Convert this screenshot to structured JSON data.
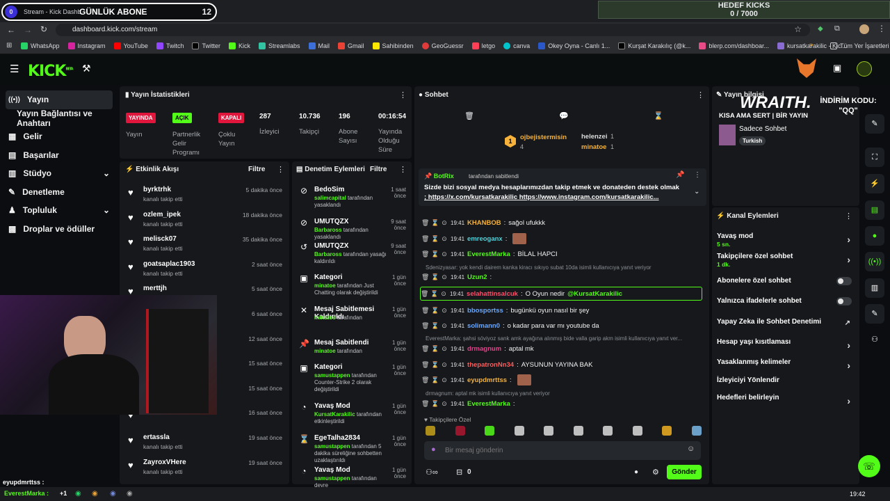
{
  "overlay": {
    "abone_title": "GÜNLÜK ABONE",
    "abone_left": "0",
    "abone_count": "12",
    "hedef_title": "HEDEF KICKS",
    "hedef_value": "0 / 7000"
  },
  "browser": {
    "tab_title": "Stream - Kick Dashb",
    "url": "dashboard.kick.com/stream",
    "all_bookmarks": "Tüm Yer İşaretleri"
  },
  "bookmarks": [
    "WhatsApp",
    "Instagram",
    "YouTube",
    "Twitch",
    "Twitter",
    "Kick",
    "Streamlabs",
    "Mail",
    "Gmail",
    "Sahibinden",
    "GeoGuessr",
    "letgo",
    "canva",
    "Okey Oyna - Canlı 1...",
    "Kurşat Karakılıç (@k...",
    "blerp.com/dashboar...",
    "kursatkarakilic - Kic..."
  ],
  "kick": {
    "logo": "KICK",
    "beta": "BETA"
  },
  "sidebar": {
    "items": [
      "Yayın",
      "Yayın Bağlantısı ve Anahtarı",
      "Gelir",
      "Başarılar",
      "Stüdyo",
      "Denetleme",
      "Topluluk",
      "Droplar ve ödüller"
    ]
  },
  "stats": {
    "title": "Yayın İstatistikleri",
    "yayinda": "YAYINDA",
    "yayin": "Yayın",
    "acik": "AÇIK",
    "partner": "Partnerlik Gelir Programı",
    "kapali": "KAPALI",
    "coklu": "Çoklu Yayın",
    "izleyici_v": "287",
    "izleyici": "İzleyici",
    "takipci_v": "10.736",
    "takipci": "Takipçi",
    "abone_v": "196",
    "abone": "Abone Sayısı",
    "sure_v": "00:16:54",
    "sure": "Yayında Olduğu Süre"
  },
  "events": {
    "title": "Etkinlik Akışı",
    "filter": "Filtre",
    "items": [
      {
        "name": "byrktrhk",
        "sub": "kanalı takip etti",
        "time": "5 dakika önce"
      },
      {
        "name": "ozlem_ipek",
        "sub": "kanalı takip etti",
        "time": "18 dakika önce"
      },
      {
        "name": "melisck07",
        "sub": "kanalı takip etti",
        "time": "35 dakika önce"
      },
      {
        "name": "goatsaplac1903",
        "sub": "kanalı takip etti",
        "time": "2 saat önce"
      },
      {
        "name": "merttjh",
        "sub": "",
        "time": "5 saat önce"
      },
      {
        "name": "",
        "sub": "",
        "time": "6 saat önce"
      },
      {
        "name": "",
        "sub": "",
        "time": "12 saat önce"
      },
      {
        "name": "",
        "sub": "",
        "time": "15 saat önce"
      },
      {
        "name": "",
        "sub": "",
        "time": "15 saat önce"
      },
      {
        "name": "",
        "sub": "",
        "time": "16 saat önce"
      },
      {
        "name": "ertassla",
        "sub": "kanalı takip etti",
        "time": "19 saat önce"
      },
      {
        "name": "ZayroxVHere",
        "sub": "kanalı takip etti",
        "time": "19 saat önce"
      }
    ]
  },
  "modlog": {
    "title": "Denetim Eylemleri",
    "filter": "Filtre",
    "items": [
      {
        "name": "BedoSim",
        "sub1": "salimcapital",
        "sub2": " tarafından yasaklandı",
        "time": "1 saat önce"
      },
      {
        "name": "UMUTQZX",
        "sub1": "Barbaross",
        "sub2": " tarafından yasaklandı",
        "time": "9 saat önce"
      },
      {
        "name": "UMUTQZX",
        "sub1": "Barbaross",
        "sub2": " tarafından yasağı kaldırıldı",
        "time": "9 saat önce"
      },
      {
        "name": "Kategori",
        "sub1": "minatoe",
        "sub2": " tarafından Just Chatting olarak değiştirildi",
        "time": "1 gün önce"
      },
      {
        "name": "Mesaj Sabitlemesi Kaldırıldı",
        "sub1": "minatoe",
        "sub2": " tarafından",
        "time": "1 gün önce"
      },
      {
        "name": "Mesaj Sabitlendi",
        "sub1": "minatoe",
        "sub2": " tarafından",
        "time": "1 gün önce"
      },
      {
        "name": "Kategori",
        "sub1": "samustappen",
        "sub2": " tarafından Counter-Strike 2 olarak değiştirildi",
        "time": "1 gün önce"
      },
      {
        "name": "Yavaş Mod",
        "sub1": "KursatKarakilic",
        "sub2": " tarafından etkinleştirildi",
        "time": "1 gün önce"
      },
      {
        "name": "EgeTalha2834",
        "sub1": "samustappen",
        "sub2": " tarafından 5 dakika süreliğine sohbetten uzaklaştırıldı",
        "time": "1 gün önce"
      },
      {
        "name": "Yavaş Mod",
        "sub1": "samustappen",
        "sub2": " tarafından devre",
        "time": "1 gün önce"
      }
    ]
  },
  "chat": {
    "title": "Sohbet",
    "top1": "ojbejistermisin",
    "top1_count": "4",
    "top2": "helenzei",
    "top2_count": "1",
    "top3": "minatoe",
    "top3_count": "1",
    "pinned_by": "BotRix",
    "pinned_label": " tarafından sabitlendi",
    "pinned_text": "Sizde bizi sosyal medya hesaplarımızdan takip etmek ve donateden destek olmak için",
    "pinned_links": "; https://x.com/kursatkarakilic https://www.instagram.com/kursatkarakilic...",
    "lines": [
      {
        "time": "19:41",
        "user": "KHANBOB",
        "color": "#f6b23a",
        "text": "sağol ufukkk"
      },
      {
        "time": "19:41",
        "user": "emreoganx",
        "color": "#4fd1d9",
        "text": ""
      },
      {
        "time": "19:41",
        "user": "EverestMarka",
        "color": "#53fc18",
        "text": "BİLAL HAPCI"
      },
      {
        "time": "19:41",
        "user": "Uzun2",
        "color": "#53fc18",
        "text": ""
      },
      {
        "time": "19:41",
        "user": "selahattinsalcuk",
        "color": "#ff4d6a",
        "text": "O Oyun nedir ",
        "mention": "@KursatKarakilic"
      },
      {
        "time": "19:41",
        "user": "bbosportss",
        "color": "#6aa8ff",
        "text": "bugünkü oyun nasıl bir şey"
      },
      {
        "time": "19:41",
        "user": "solimann0",
        "color": "#6aa8ff",
        "text": "o kadar para var mı youtube da"
      },
      {
        "time": "19:41",
        "user": "drmagnum",
        "color": "#e0448a",
        "text": "aptal mk"
      },
      {
        "time": "19:41",
        "user": "thepatronNn34",
        "color": "#ff5b5b",
        "text": "AYSUNUN YAYINA BAK"
      },
      {
        "time": "19:41",
        "user": "eyupdmrttss",
        "color": "#f6b23a",
        "text": ""
      },
      {
        "time": "19:41",
        "user": "EverestMarka",
        "color": "#53fc18",
        "text": ""
      }
    ],
    "sys1": "Sdenizyasar: yok kendi dairem kanka kiracı sıkıyo subat 10da isimli kullanıcıya yanıt veriyor",
    "sys2": "EverestMarka: şahsi söviyoz sank amk ayağına alınmış bide valla garip akm isimli kullanıcıya yanıt ver...",
    "sys3": "drmagnum: aptal mk isimli kullanıcıya yanıt veriyor",
    "followers_only": "Takipçilere Özel",
    "placeholder": "Bir mesaj gönderin",
    "send": "Gönder",
    "count": "0"
  },
  "streaminfo": {
    "title": "Yayın bilgisi",
    "brand": "WRAITH.",
    "promo": "İNDİRİM KODU: \"QQ\"",
    "line": "KISA AMA SERT | BİR YAYIN",
    "category": "Sadece Sohbet",
    "tag": "Turkish"
  },
  "actions": {
    "title": "Kanal Eylemleri",
    "slow": "Yavaş mod",
    "slow_v": "5 sn.",
    "fo": "Takipçilere özel sohbet",
    "fo_v": "1 dk.",
    "sub": "Abonelere özel sohbet",
    "emote": "Yalnızca ifadelerle sohbet",
    "ai": "Yapay Zeka ile Sohbet Denetimi",
    "age": "Hesap yaşı kısıtlaması",
    "banned": "Yasaklanmış kelimeler",
    "redirect": "İzleyiciyi Yönlendir",
    "goals": "Hedefleri belirleyin"
  },
  "taskbar": {
    "time": "19:42",
    "chat1_user": "eyupdmrttss :",
    "chat2_user": "EverestMarka :",
    "chat2_text": "+1"
  },
  "colors": {
    "kick_green": "#53fc18",
    "panel": "#16181b",
    "bg": "#0b0d10"
  }
}
